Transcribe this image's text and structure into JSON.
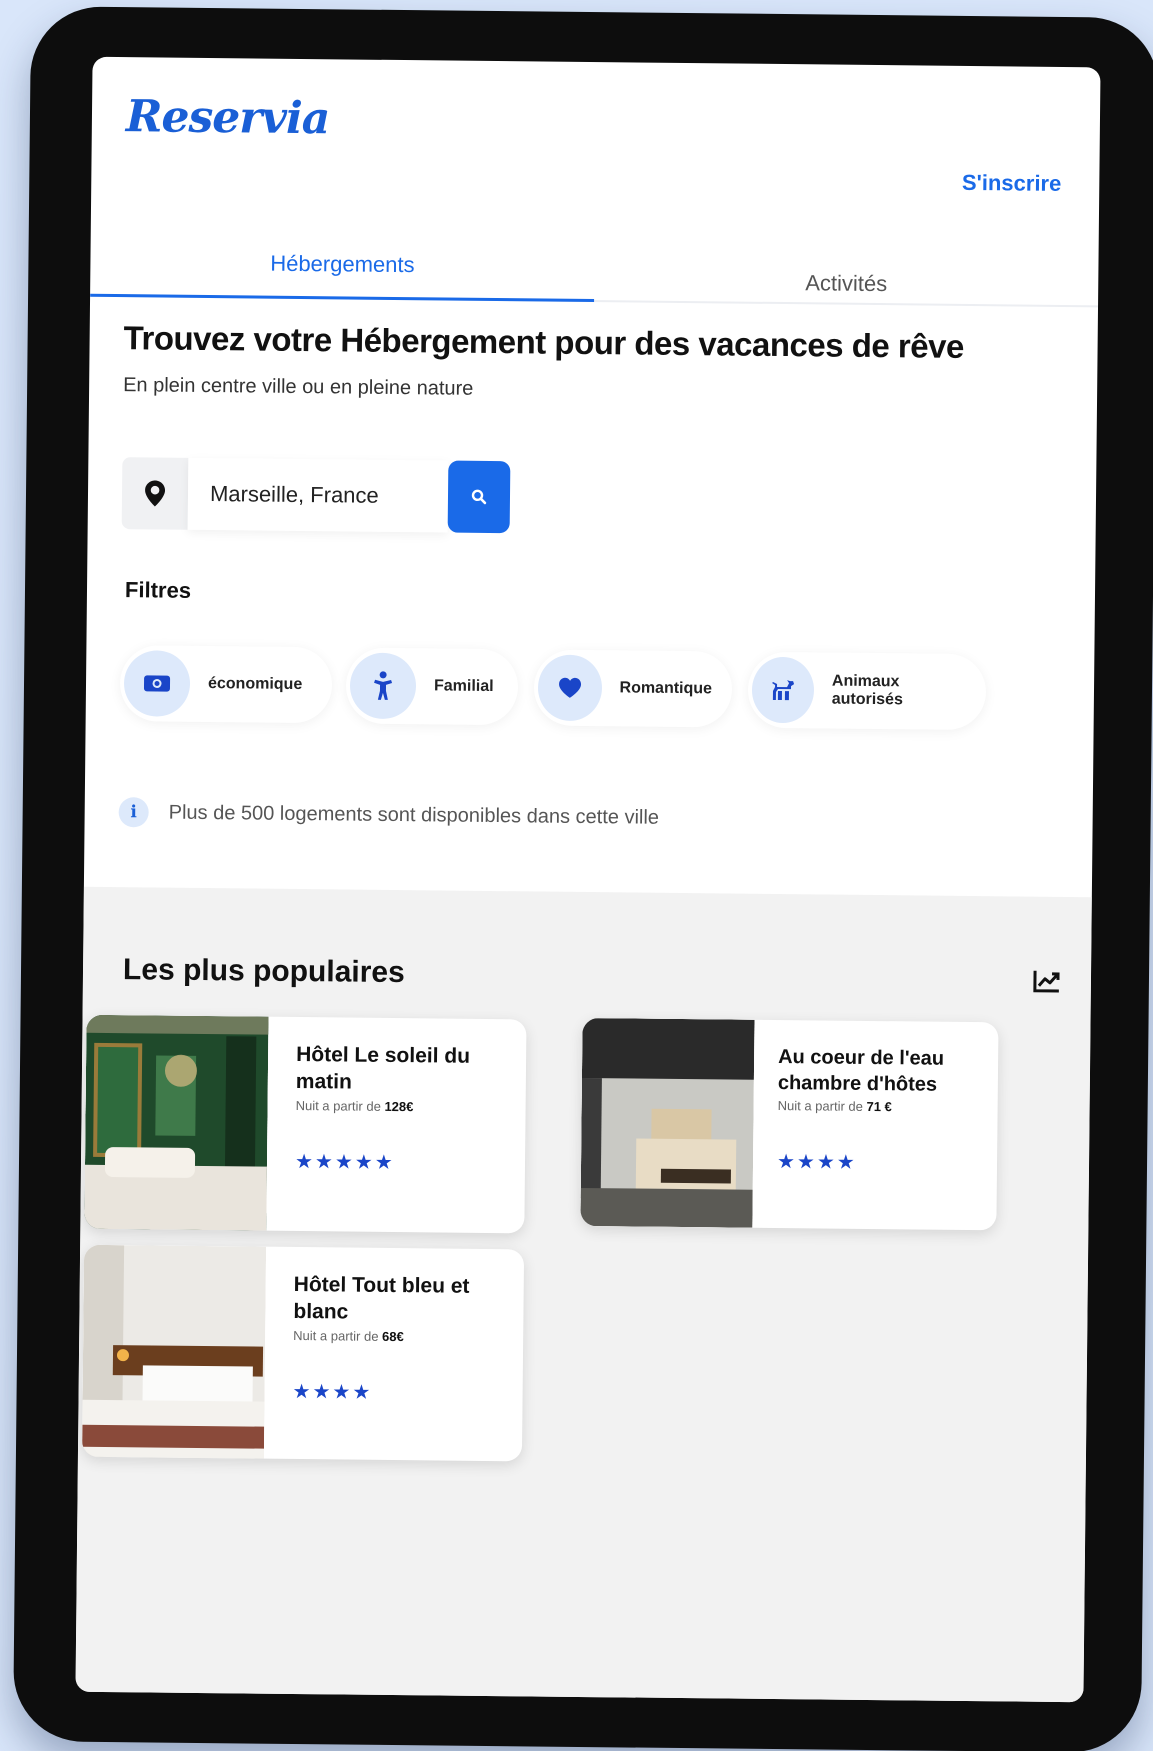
{
  "header": {
    "brand": "Reservia",
    "signup_label": "S'inscrire"
  },
  "tabs": [
    {
      "label": "Hébergements",
      "active": true
    },
    {
      "label": "Activités",
      "active": false
    }
  ],
  "hero": {
    "title": "Trouvez votre Hébergement pour des vacances de rêve",
    "subtitle": "En plein centre ville ou en pleine nature"
  },
  "search": {
    "value": "Marseille, France",
    "pin_icon": "map-pin-icon",
    "button_icon": "search-icon"
  },
  "filters": {
    "title": "Filtres",
    "items": [
      {
        "label": "économique",
        "icon": "money-icon"
      },
      {
        "label": "Familial",
        "icon": "person-icon"
      },
      {
        "label": "Romantique",
        "icon": "heart-icon"
      },
      {
        "label": "Animaux autorisés",
        "icon": "dog-icon"
      }
    ]
  },
  "info": {
    "icon_glyph": "i",
    "text": "Plus de 500 logements sont disponibles dans cette ville"
  },
  "popular": {
    "title": "Les plus populaires",
    "icon": "trend-chart-icon",
    "cards": [
      {
        "name": "Hôtel Le soleil du matin",
        "price_prefix": "Nuit a partir de ",
        "price": "128€",
        "stars": 5
      },
      {
        "name": "Au coeur de l'eau chambre d'hôtes",
        "price_prefix": "Nuit a partir de ",
        "price": "71 €",
        "stars": 4
      },
      {
        "name": "Hôtel Tout bleu et blanc",
        "price_prefix": "Nuit a partir de ",
        "price": "68€",
        "stars": 4
      }
    ]
  },
  "colors": {
    "accent": "#1a6ae8",
    "chip_bg": "#dde9fb",
    "section_bg": "#f2f2f2"
  }
}
